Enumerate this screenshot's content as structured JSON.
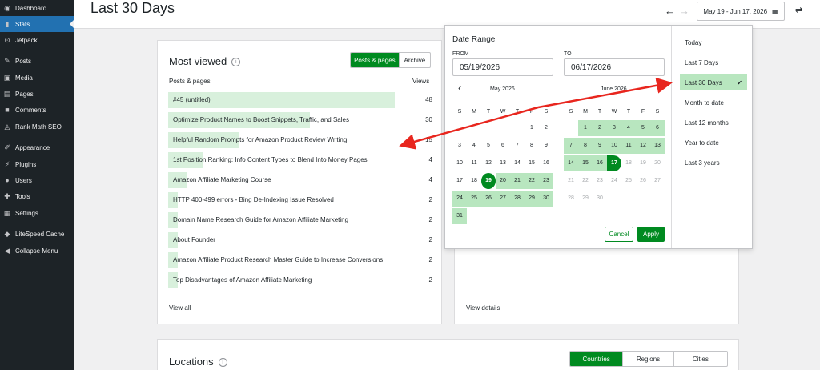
{
  "sidebar": {
    "items": [
      {
        "label": "Dashboard",
        "icon": "dashboard-icon",
        "glyph": "◉"
      },
      {
        "label": "Stats",
        "icon": "stats-icon",
        "glyph": "▮"
      },
      {
        "label": "Jetpack",
        "icon": "jetpack-icon",
        "glyph": "⊙"
      },
      {
        "label": "Posts",
        "icon": "pin-icon",
        "glyph": "✎"
      },
      {
        "label": "Media",
        "icon": "media-icon",
        "glyph": "▣"
      },
      {
        "label": "Pages",
        "icon": "pages-icon",
        "glyph": "▤"
      },
      {
        "label": "Comments",
        "icon": "comments-icon",
        "glyph": "■"
      },
      {
        "label": "Rank Math SEO",
        "icon": "rank-math-icon",
        "glyph": "◬"
      },
      {
        "label": "Appearance",
        "icon": "brush-icon",
        "glyph": "✐"
      },
      {
        "label": "Plugins",
        "icon": "plugin-icon",
        "glyph": "⚡"
      },
      {
        "label": "Users",
        "icon": "users-icon",
        "glyph": "●"
      },
      {
        "label": "Tools",
        "icon": "wrench-icon",
        "glyph": "✚"
      },
      {
        "label": "Settings",
        "icon": "settings-icon",
        "glyph": "▦"
      },
      {
        "label": "LiteSpeed Cache",
        "icon": "litespeed-icon",
        "glyph": "◆"
      },
      {
        "label": "Collapse Menu",
        "icon": "collapse-icon",
        "glyph": "◀"
      }
    ]
  },
  "header": {
    "title": "Last 30 Days",
    "prev_glyph": "←",
    "next_glyph": "→",
    "date_range": "May 19 - Jun 17, 2026",
    "calendar_glyph": "▦",
    "filter_glyph": "⇌"
  },
  "most_viewed": {
    "title": "Most viewed",
    "info_glyph": "i",
    "toggle": [
      "Posts & pages",
      "Archive"
    ],
    "col_left": "Posts & pages",
    "col_right": "Views",
    "rows": [
      {
        "title": "#45 (untitled)",
        "views": "48",
        "views_num": 48
      },
      {
        "title": "Optimize Product Names to Boost Snippets, Traffic, and Sales",
        "views": "30",
        "views_num": 30
      },
      {
        "title": "Helpful Random Prompts for Amazon Product Review Writing",
        "views": "15",
        "views_num": 15
      },
      {
        "title": "1st Position Ranking: Info Content Types to Blend Into Money Pages",
        "views": "4",
        "views_num": 4
      },
      {
        "title": "Amazon Affiliate Marketing Course",
        "views": "4",
        "views_num": 4
      },
      {
        "title": "HTTP 400-499 errors - Bing De-Indexing Issue Resolved",
        "views": "2",
        "views_num": 2
      },
      {
        "title": "Domain Name Research Guide for Amazon Affiliate Marketing",
        "views": "2",
        "views_num": 2
      },
      {
        "title": "About Founder",
        "views": "2",
        "views_num": 2
      },
      {
        "title": "Amazon Affiliate Product Research Master Guide to Increase Conversions",
        "views": "2",
        "views_num": 2
      },
      {
        "title": "Top Disadvantages of Amazon Affiliate Marketing",
        "views": "2",
        "views_num": 2
      }
    ],
    "view_all": "View all"
  },
  "second_card": {
    "view_details": "View details"
  },
  "locations": {
    "title": "Locations",
    "info_glyph": "i",
    "tabs": [
      "Countries",
      "Regions",
      "Cities"
    ]
  },
  "date_picker": {
    "title": "Date Range",
    "from_label": "FROM",
    "to_label": "TO",
    "from_value": "05/19/2026",
    "to_value": "06/17/2026",
    "prev_glyph": "‹",
    "months": [
      "May 2026",
      "June 2026"
    ],
    "weekdays": [
      "S",
      "M",
      "T",
      "W",
      "T",
      "F",
      "S"
    ],
    "cancel": "Cancel",
    "apply": "Apply",
    "presets": [
      "Today",
      "Last 7 Days",
      "Last 30 Days",
      "Month to date",
      "Last 12 months",
      "Year to date",
      "Last 3 years"
    ],
    "selected_preset": "Last 30 Days",
    "check_glyph": "✔"
  },
  "colors": {
    "accent_green": "#008a20",
    "range_green": "#b8e6bf",
    "annotation_red": "#e8261e"
  }
}
